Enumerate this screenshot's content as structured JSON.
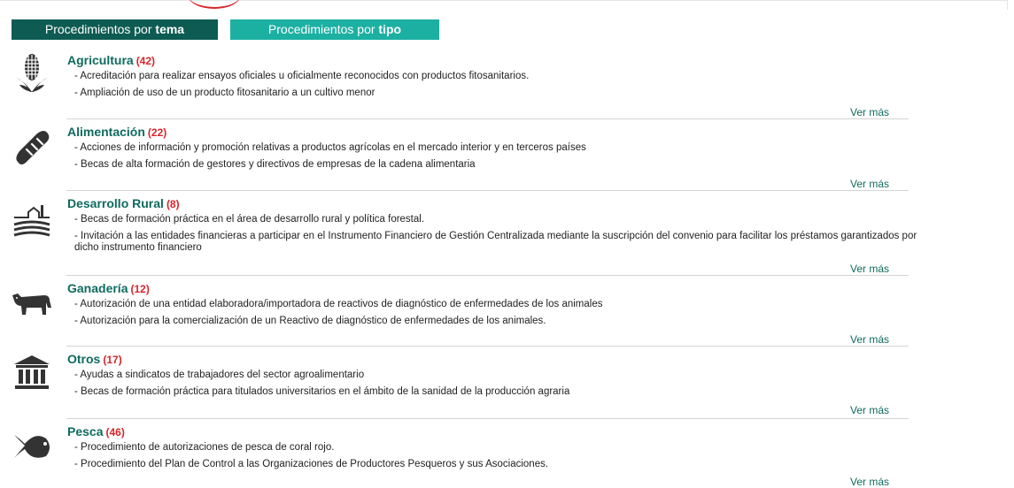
{
  "tabs": {
    "tema_prefix": "Procedimientos por ",
    "tema_bold": "tema",
    "tipo_prefix": "Procedimientos por ",
    "tipo_bold": "tipo"
  },
  "categories": [
    {
      "name": "Agricultura",
      "count": "(42)",
      "icon": "corn-icon",
      "items": [
        "- Acreditación para realizar ensayos oficiales u oficialmente reconocidos con productos fitosanitarios.",
        "- Ampliación de uso de un producto fitosanitario a un cultivo menor"
      ],
      "more": "Ver más"
    },
    {
      "name": "Alimentación",
      "count": "(22)",
      "icon": "bread-icon",
      "items": [
        "- Acciones de información y promoción relativas a productos agrícolas en el mercado interior y en terceros países",
        "- Becas de alta formación de gestores y directivos de empresas de la cadena alimentaria"
      ],
      "more": "Ver más"
    },
    {
      "name": "Desarrollo Rural",
      "count": "(8)",
      "icon": "rural-landscape-icon",
      "items": [
        "- Becas de formación práctica en el área de desarrollo rural y política forestal.",
        "- Invitación a las entidades financieras a participar en el Instrumento Financiero de Gestión Centralizada mediante la suscripción del convenio para facilitar los préstamos garantizados por dicho instrumento financiero"
      ],
      "more": "Ver más"
    },
    {
      "name": "Ganadería",
      "count": "(12)",
      "icon": "cow-icon",
      "items": [
        "- Autorización de una entidad elaboradora/importadora de reactivos de diagnóstico de enfermedades de los animales",
        "- Autorización para la comercialización de un Reactivo de diagnóstico de enfermedades de los animales."
      ],
      "more": "Ver más"
    },
    {
      "name": "Otros",
      "count": "(17)",
      "icon": "institution-icon",
      "items": [
        "- Ayudas a sindicatos de trabajadores del sector agroalimentario",
        "- Becas de formación práctica para titulados universitarios en el ámbito de la sanidad de la producción agraria"
      ],
      "more": "Ver más"
    },
    {
      "name": "Pesca",
      "count": "(46)",
      "icon": "fish-icon",
      "items": [
        "- Procedimiento de autorizaciones de pesca de coral rojo.",
        "- Procedimiento del Plan de Control a las Organizaciones de Productores Pesqueros y sus Asociaciones."
      ],
      "more": "Ver más"
    }
  ]
}
